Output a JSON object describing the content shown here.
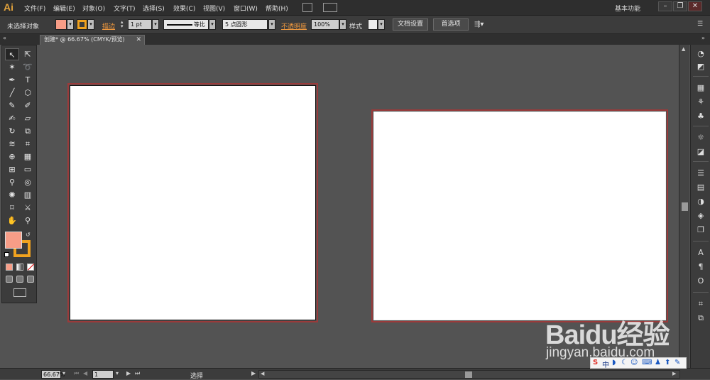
{
  "app": {
    "logo": "Ai",
    "accent_color": "#e2a33c"
  },
  "menu": {
    "items": [
      "文件(F)",
      "编辑(E)",
      "对象(O)",
      "文字(T)",
      "选择(S)",
      "效果(C)",
      "视图(V)",
      "窗口(W)",
      "帮助(H)"
    ],
    "workspace": "基本功能"
  },
  "window_controls": {
    "minimize": "–",
    "restore": "❐",
    "close": "✕"
  },
  "control_bar": {
    "selection_status": "未选择对象",
    "fill_color": "#f79d87",
    "stroke_label": "描边",
    "stroke_weight": "1 pt",
    "stroke_profile": "等比",
    "brush": "5 点圆形",
    "opacity_label": "不透明度",
    "opacity_value": "100%",
    "style_label": "样式",
    "doc_setup_button": "文档设置",
    "preferences_button": "首选项"
  },
  "document_tab": {
    "title": "创建* @ 66.67% (CMYK/预览)",
    "close": "✕"
  },
  "tools": {
    "fill_color": "#f79d87",
    "stroke_color": "#f0a21f",
    "icons": [
      "selection-tool-icon",
      "direct-selection-tool-icon",
      "magic-wand-tool-icon",
      "lasso-tool-icon",
      "pen-tool-icon",
      "type-tool-icon",
      "line-tool-icon",
      "ellipse-tool-icon",
      "paintbrush-tool-icon",
      "pencil-tool-icon",
      "blob-brush-tool-icon",
      "eraser-tool-icon",
      "rotate-tool-icon",
      "scale-tool-icon",
      "warp-tool-icon",
      "free-transform-tool-icon",
      "shape-builder-tool-icon",
      "perspective-grid-tool-icon",
      "mesh-tool-icon",
      "gradient-tool-icon",
      "eyedropper-tool-icon",
      "blend-tool-icon",
      "symbol-sprayer-tool-icon",
      "column-graph-tool-icon",
      "artboard-tool-icon",
      "slice-tool-icon",
      "hand-tool-icon",
      "zoom-tool-icon"
    ]
  },
  "status_bar": {
    "zoom": "66.67%",
    "artboard_number": "1",
    "tool_status": "选择"
  },
  "watermark": {
    "main": "Baidu经验",
    "sub": "jingyan.baidu.com"
  },
  "ime": {
    "label": "中"
  }
}
